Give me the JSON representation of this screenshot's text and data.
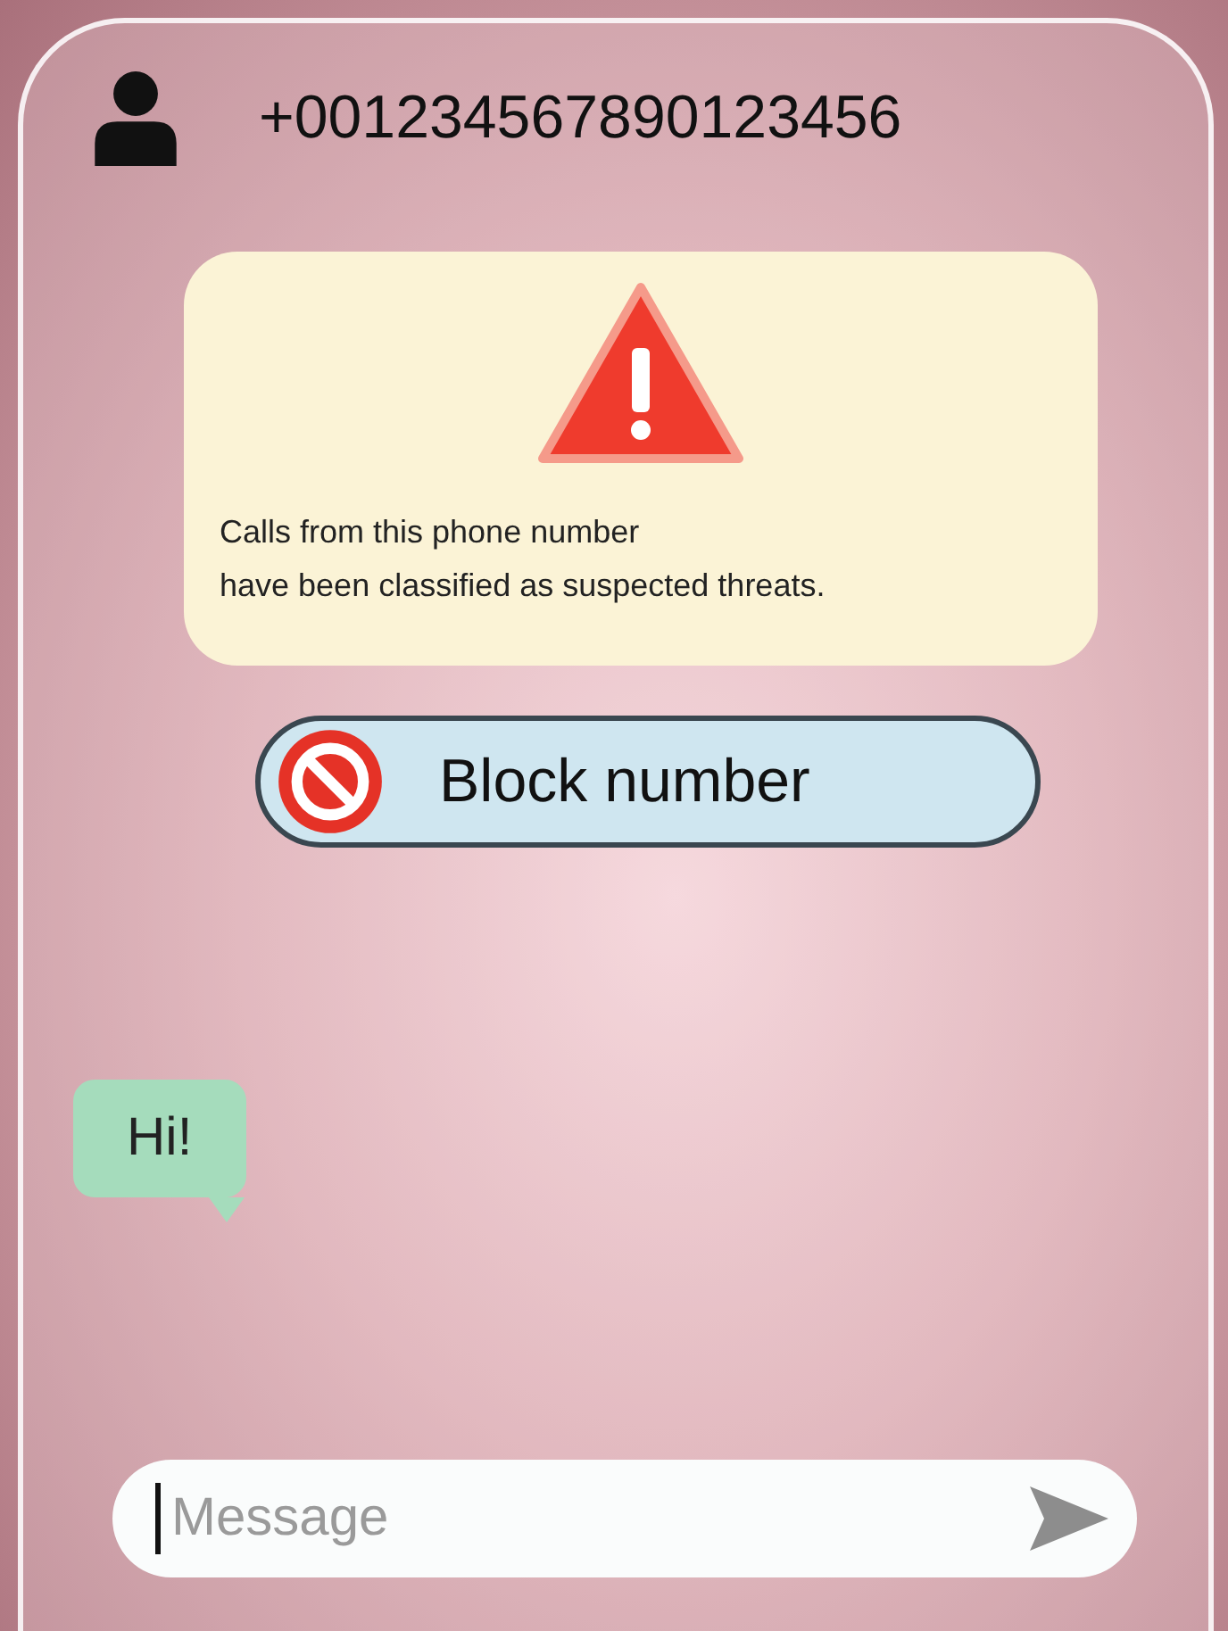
{
  "header": {
    "phone_number": "+001234567890123456"
  },
  "warning": {
    "message": "Calls from this phone number\nhave been classified as suspected threats."
  },
  "block_button": {
    "label": "Block number"
  },
  "messages": [
    {
      "text": "Hi!"
    }
  ],
  "composer": {
    "placeholder": "Message"
  }
}
